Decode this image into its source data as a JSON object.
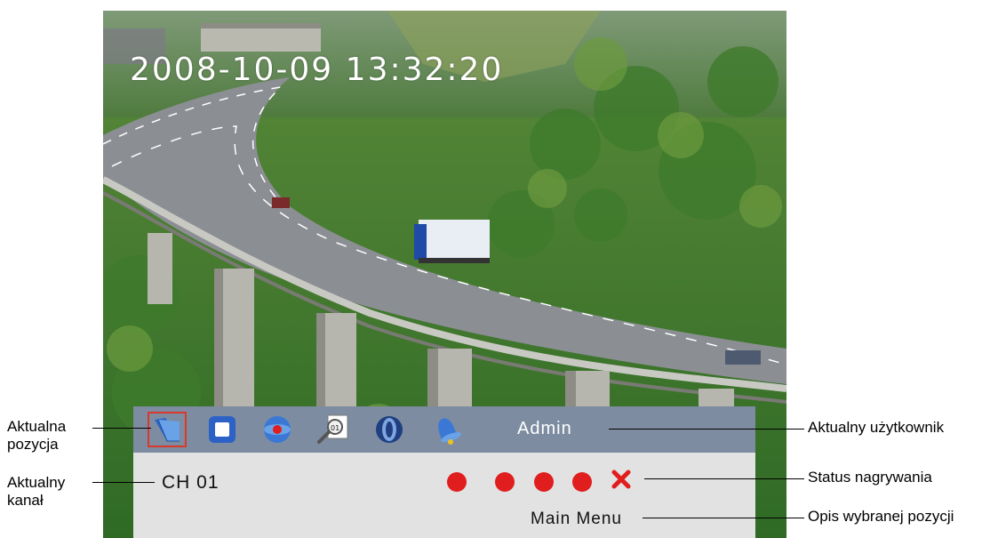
{
  "video": {
    "timestamp": "2008-10-09 13:32:20"
  },
  "osd": {
    "toolbar_icons": [
      {
        "name": "folder-icon",
        "selected": true
      },
      {
        "name": "stop-icon",
        "selected": false
      },
      {
        "name": "record-disc-icon",
        "selected": false
      },
      {
        "name": "search-icon",
        "selected": false
      },
      {
        "name": "playback-icon",
        "selected": false
      },
      {
        "name": "bell-icon",
        "selected": false
      }
    ],
    "user": "Admin",
    "channel": "CH 01",
    "recording_status": [
      {
        "state": "recording",
        "color": "#e01e1e"
      },
      {
        "state": "recording",
        "color": "#e01e1e"
      },
      {
        "state": "recording",
        "color": "#e01e1e"
      },
      {
        "state": "recording",
        "color": "#e01e1e"
      },
      {
        "state": "off",
        "color": "#e01e1e"
      }
    ],
    "selected_description": "Main Menu",
    "bar_color": "#7d8ca0",
    "panel_color": "#e2e2e2",
    "selection_color": "#d9382c"
  },
  "callouts": {
    "current_position": "Aktualna\npozycja",
    "current_position_line1": "Aktualna",
    "current_position_line2": "pozycja",
    "current_channel_line1": "Aktualny",
    "current_channel_line2": "kanał",
    "current_user": "Aktualny użytkownik",
    "recording_status": "Status nagrywania",
    "selected_description": "Opis wybranej pozycji"
  }
}
